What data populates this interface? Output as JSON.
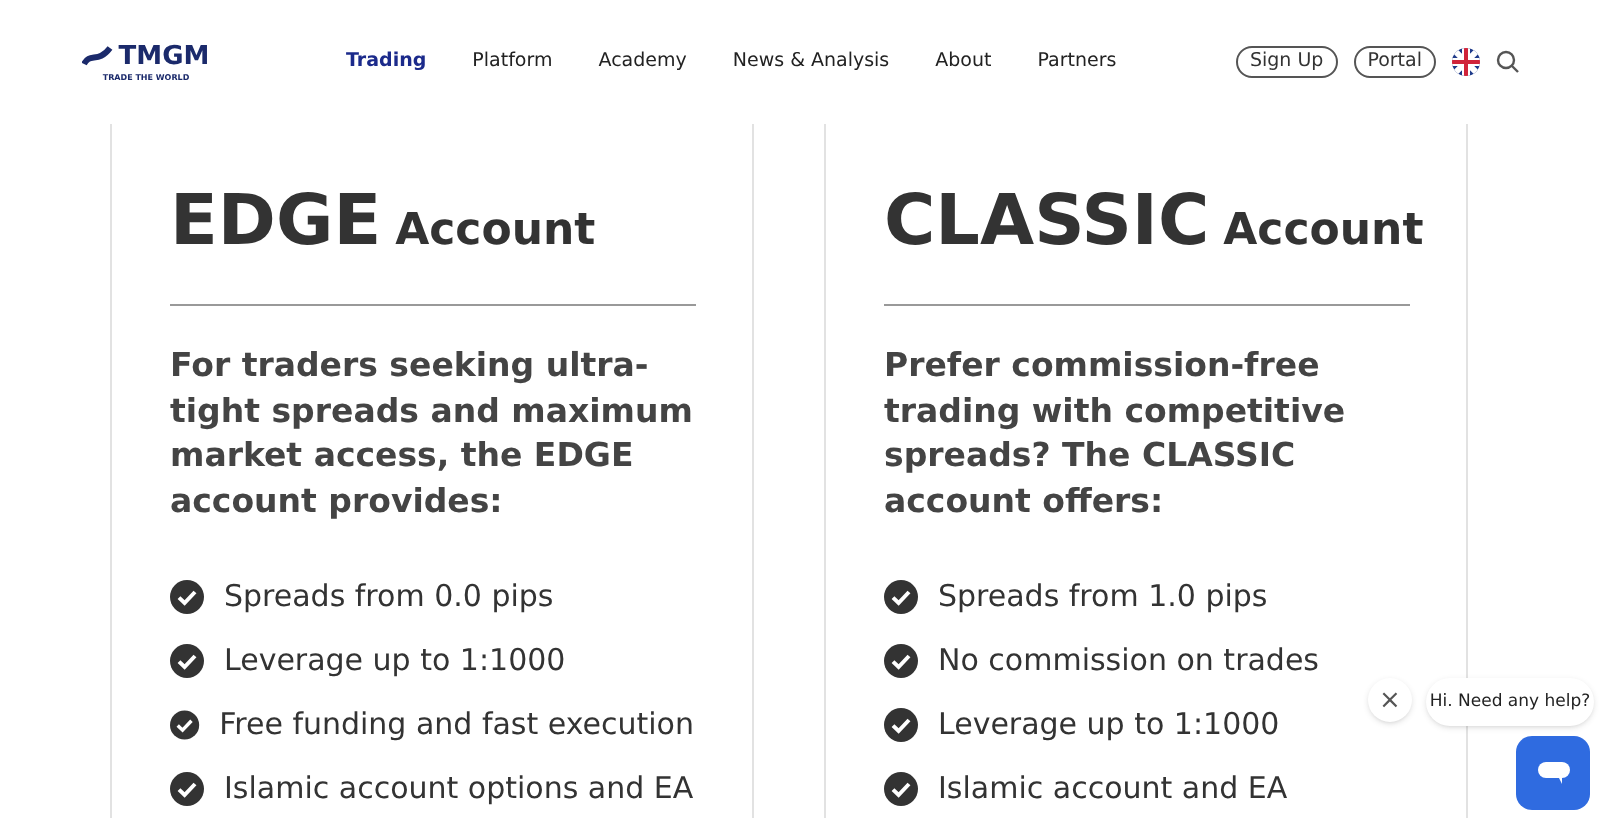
{
  "header": {
    "logo": {
      "name": "TMGM",
      "tagline": "TRADE THE WORLD"
    },
    "nav": [
      {
        "label": "Trading",
        "selected": true
      },
      {
        "label": "Platform",
        "selected": false
      },
      {
        "label": "Academy",
        "selected": false
      },
      {
        "label": "News & Analysis",
        "selected": false
      },
      {
        "label": "About",
        "selected": false
      },
      {
        "label": "Partners",
        "selected": false
      }
    ],
    "buttons": [
      "Sign Up",
      "Portal"
    ]
  },
  "cards": [
    {
      "title": "EDGE",
      "subtitle": "Account",
      "intro": "For traders seeking ultra-tight spreads and maximum market access, the EDGE account provides:",
      "features": [
        "Spreads from 0.0 pips",
        "Leverage up to 1:1000",
        "Free funding and fast execution",
        "Islamic account options and EA"
      ]
    },
    {
      "title": "CLASSIC",
      "subtitle": "Account",
      "intro": "Prefer commission-free trading with competitive spreads? The CLASSIC account offers:",
      "features": [
        "Spreads from 1.0 pips",
        "No commission on trades",
        "Leverage up to 1:1000",
        "Islamic account and EA"
      ]
    }
  ],
  "chat": {
    "message": "Hi. Need any help?",
    "close": "×"
  }
}
